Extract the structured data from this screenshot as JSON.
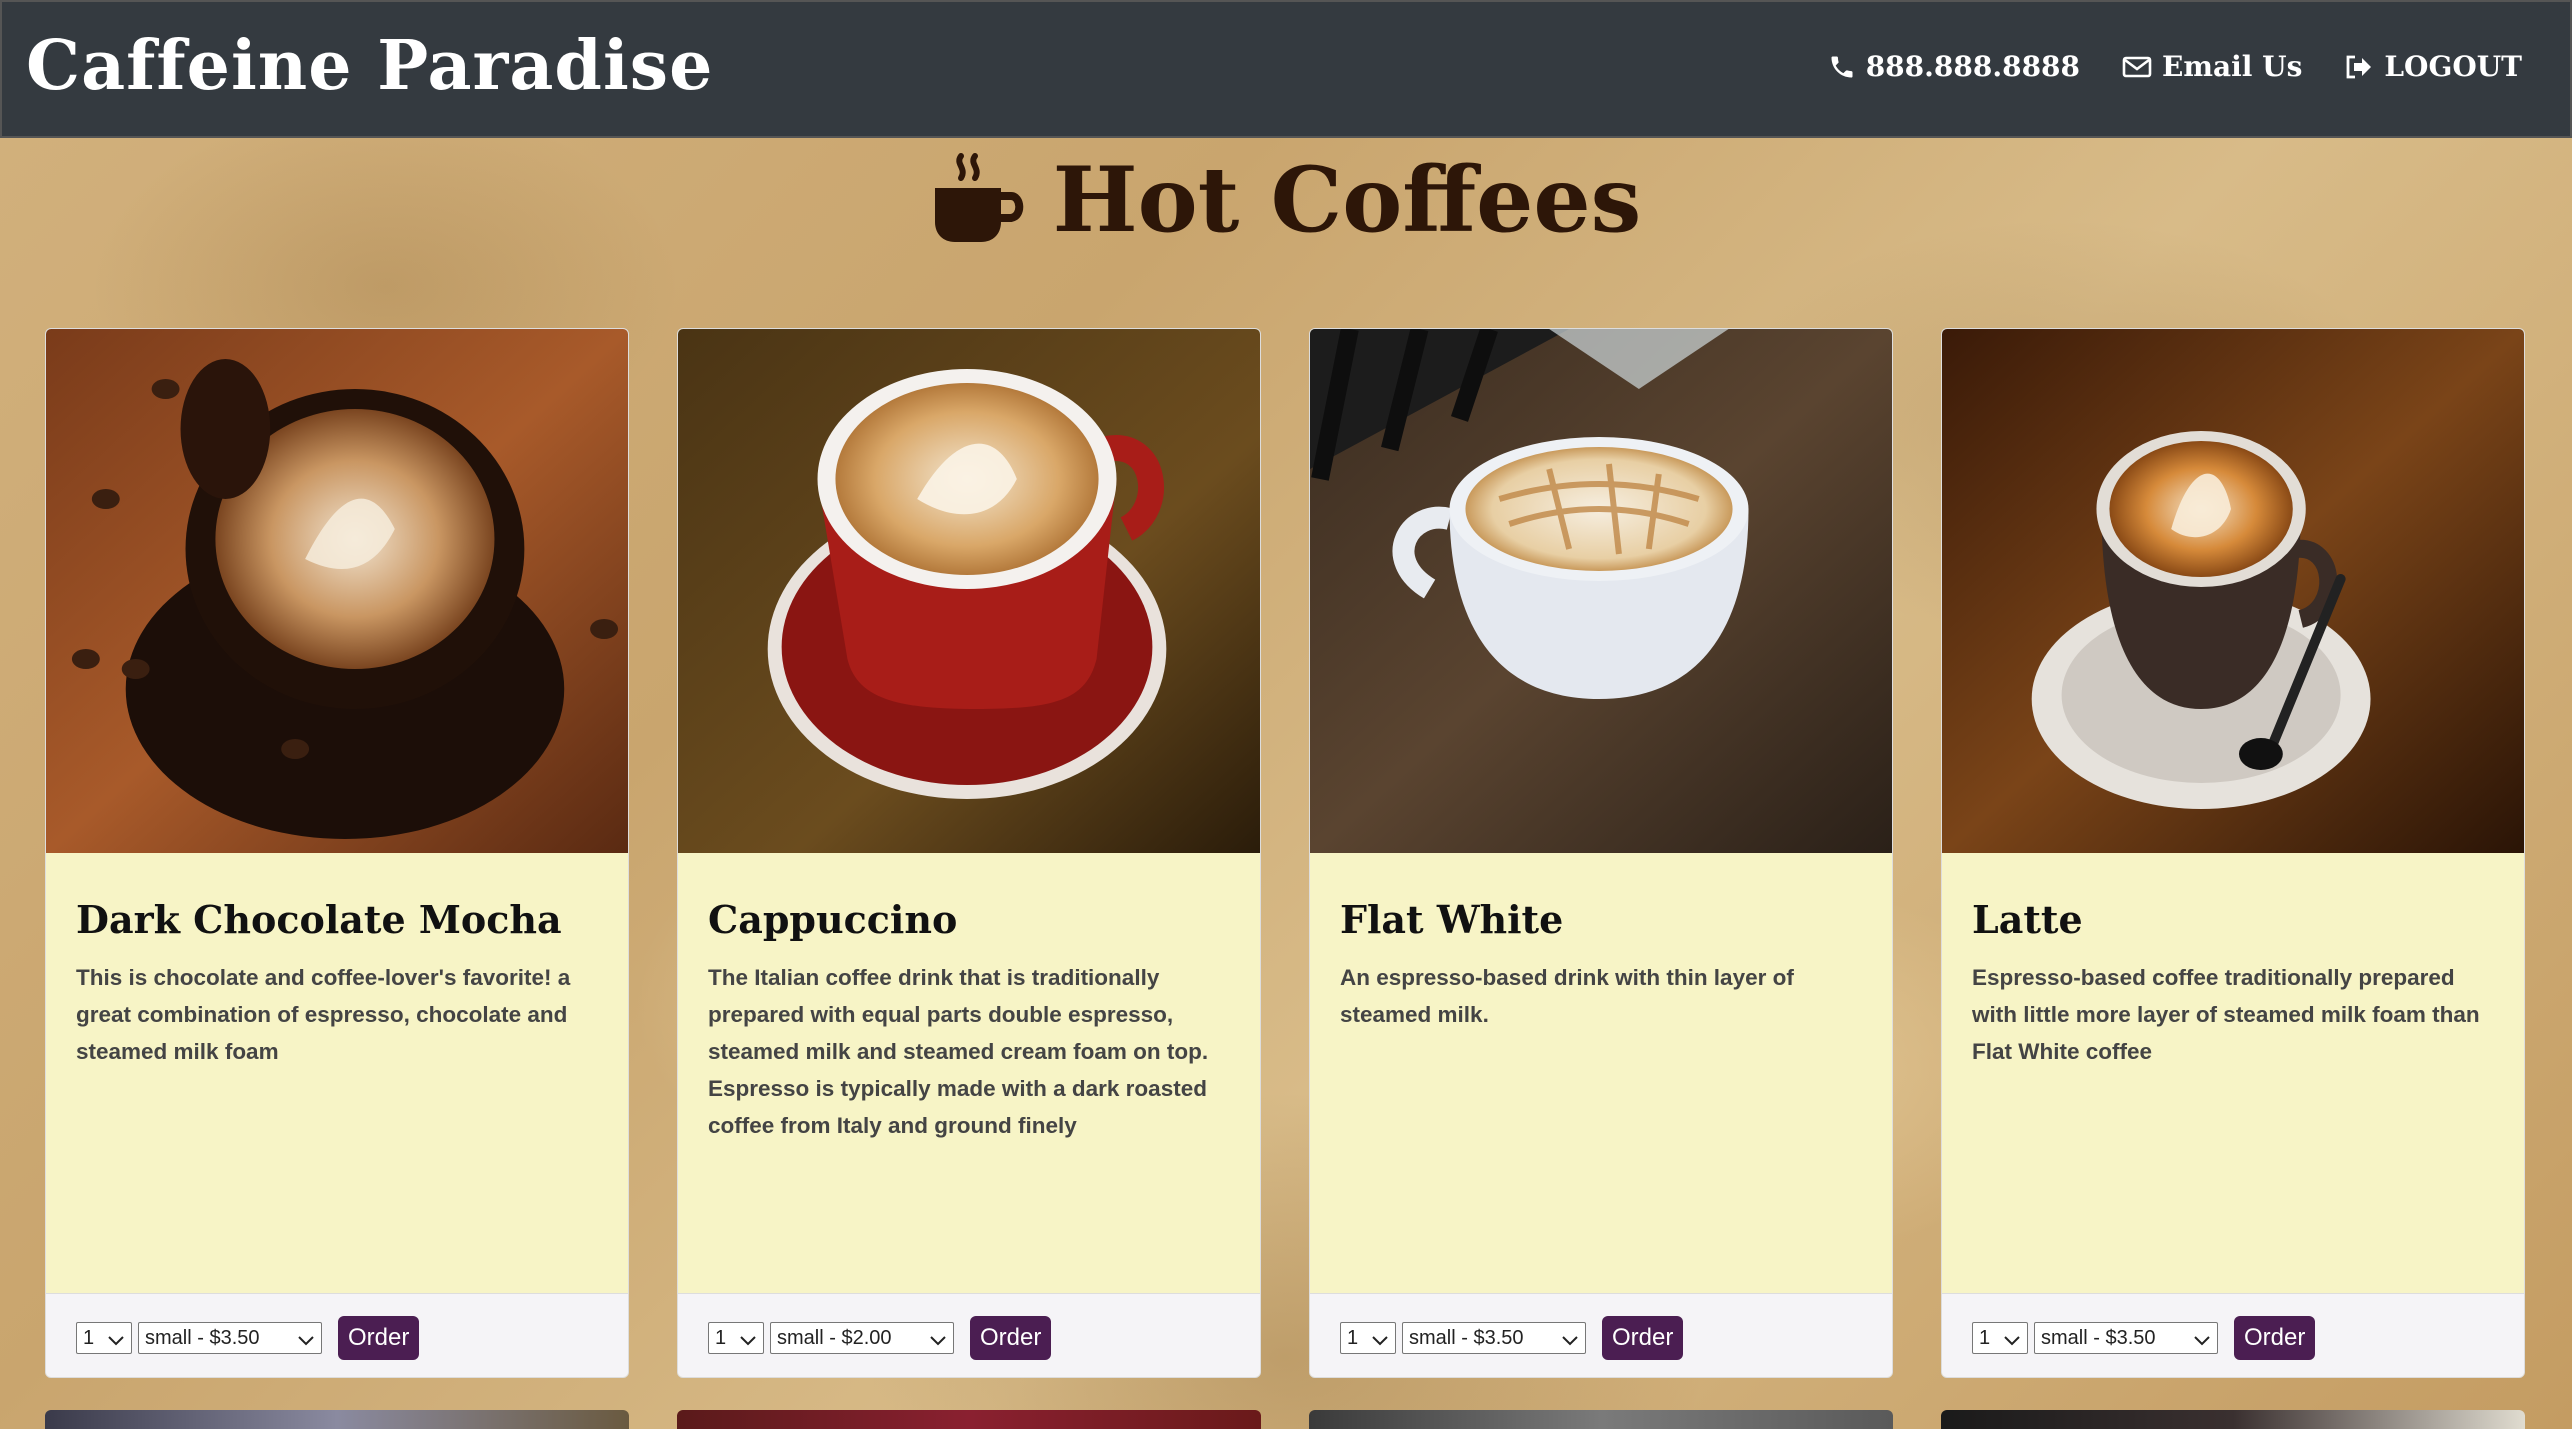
{
  "navbar": {
    "brand": "Caffeine Paradise",
    "phone": "888.888.8888",
    "email": "Email Us",
    "logout": "LOGOUT"
  },
  "section": {
    "title": "Hot Coffees"
  },
  "cards": [
    {
      "title": "Dark Chocolate Mocha",
      "description": "This is chocolate and coffee-lover's favorite! a great combination of espresso, chocolate and steamed milk foam",
      "qty": "1",
      "size": "small - $3.50",
      "order": "Order"
    },
    {
      "title": "Cappuccino",
      "description": "The Italian coffee drink that is traditionally prepared with equal parts double espresso, steamed milk and steamed cream foam on top. Espresso is typically made with a dark roasted coffee from Italy and ground finely",
      "qty": "1",
      "size": "small - $2.00",
      "order": "Order"
    },
    {
      "title": "Flat White",
      "description": "An espresso-based drink with thin layer of steamed milk.",
      "qty": "1",
      "size": "small - $3.50",
      "order": "Order"
    },
    {
      "title": "Latte",
      "description": "Espresso-based coffee traditionally prepared with little more layer of steamed milk foam than Flat White coffee",
      "qty": "1",
      "size": "small - $3.50",
      "order": "Order"
    }
  ],
  "colors": {
    "navbar": "#343a40",
    "card_body": "#f7f4c6",
    "order_button": "#4b1e52",
    "title_text": "#2d1608"
  }
}
